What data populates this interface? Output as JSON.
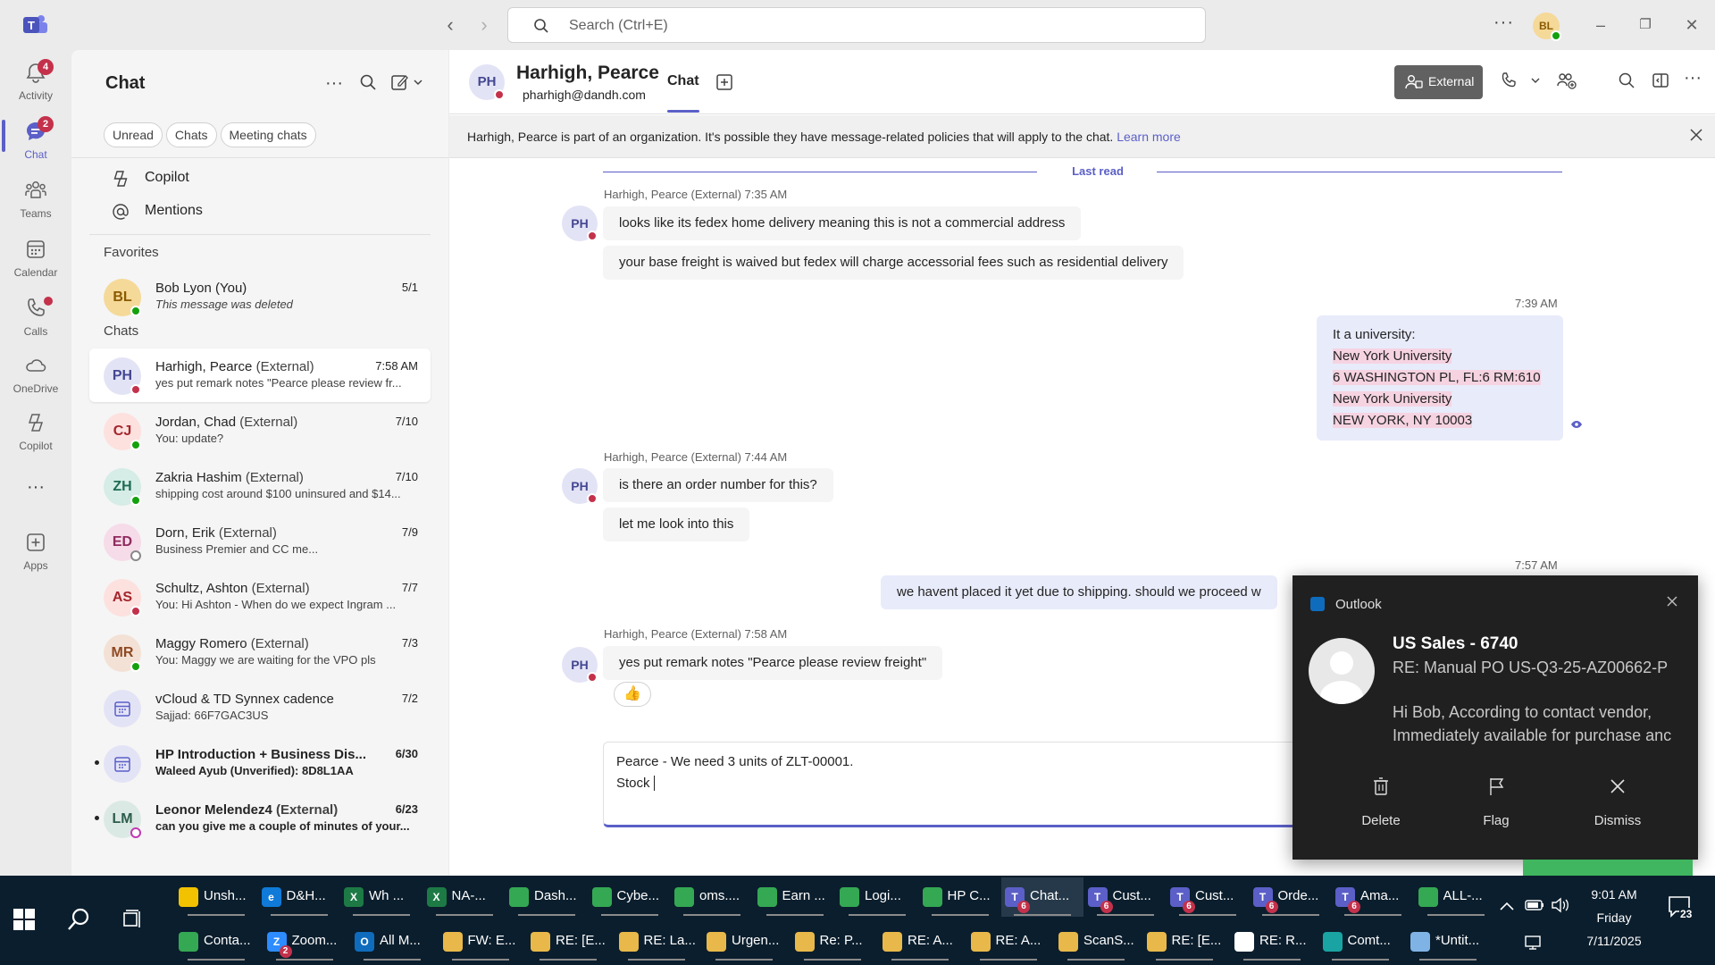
{
  "titlebar": {
    "search_placeholder": "Search (Ctrl+E)",
    "more": "···",
    "user_initials": "BL"
  },
  "rail": {
    "items": [
      {
        "label": "Activity",
        "badge": "4"
      },
      {
        "label": "Chat",
        "badge": "2"
      },
      {
        "label": "Teams"
      },
      {
        "label": "Calendar"
      },
      {
        "label": "Calls"
      },
      {
        "label": "OneDrive"
      },
      {
        "label": "Copilot"
      },
      {
        "label": "···"
      },
      {
        "label": "Apps"
      }
    ]
  },
  "list": {
    "title": "Chat",
    "filters": [
      "Unread",
      "Chats",
      "Meeting chats"
    ],
    "nav": [
      {
        "label": "Copilot"
      },
      {
        "label": "Mentions"
      }
    ],
    "favorites_label": "Favorites",
    "chats_label": "Chats",
    "favorites": [
      {
        "initials": "BL",
        "name": "Bob Lyon (You)",
        "preview": "This message was deleted",
        "date": "5/1"
      }
    ],
    "chats": [
      {
        "initials": "PH",
        "name": "Harhigh, Pearce",
        "ext": "(External)",
        "preview": "yes put remark notes \"Pearce please review fr...",
        "date": "7:58 AM"
      },
      {
        "initials": "CJ",
        "name": "Jordan, Chad",
        "ext": "(External)",
        "preview": "You: update?",
        "date": "7/10"
      },
      {
        "initials": "ZH",
        "name": "Zakria Hashim",
        "ext": "(External)",
        "preview": "shipping cost around $100 uninsured and $14...",
        "date": "7/10"
      },
      {
        "initials": "ED",
        "name": "Dorn, Erik",
        "ext": "(External)",
        "preview": "Business Premier and CC me...",
        "date": "7/9"
      },
      {
        "initials": "AS",
        "name": "Schultz, Ashton",
        "ext": "(External)",
        "preview": "You: Hi Ashton -  When do we expect Ingram ...",
        "date": "7/7"
      },
      {
        "initials": "MR",
        "name": "Maggy Romero",
        "ext": "(External)",
        "preview": "You: Maggy we are waiting for the VPO pls",
        "date": "7/3"
      },
      {
        "initials": "",
        "name": "vCloud & TD Synnex cadence",
        "ext": "",
        "preview": "Sajjad: 66F7GAC3US",
        "date": "7/2"
      },
      {
        "initials": "",
        "name": "HP Introduction + Business Dis...",
        "ext": "",
        "preview": "Waleed Ayub (Unverified): 8D8L1AA",
        "date": "6/30"
      },
      {
        "initials": "LM",
        "name": "Leonor Melendez4",
        "ext": "(External)",
        "preview": "can you give me a couple of minutes of your...",
        "date": "6/23"
      }
    ]
  },
  "header": {
    "initials": "PH",
    "name": "Harhigh, Pearce",
    "email": "pharhigh@dandh.com",
    "tab": "Chat",
    "external_label": "External"
  },
  "infobar": {
    "text": "Harhigh, Pearce is part of an organization. It's possible they have message-related policies that will apply to the chat.",
    "link": "Learn more"
  },
  "conversation": {
    "last_read": "Last read",
    "groups": [
      {
        "meta": "Harhigh, Pearce (External)  7:35 AM",
        "messages": [
          "looks like its fedex home delivery meaning this is not a commercial address",
          "your base freight is waived but fedex will charge accessorial fees such as residential delivery"
        ]
      },
      {
        "time": "7:39 AM",
        "lines": [
          "It a university:",
          "New York University",
          "6 WASHINGTON PL, FL:6 RM:610",
          "New York University",
          "NEW YORK, NY 10003"
        ]
      },
      {
        "meta": "Harhigh, Pearce (External)  7:44 AM",
        "messages": [
          "is there an order number for this?",
          "let me look into this"
        ]
      },
      {
        "time": "7:57 AM",
        "message": "we havent placed it yet due to shipping. should we proceed w"
      },
      {
        "meta": "Harhigh, Pearce (External)  7:58 AM",
        "messages": [
          "yes put remark notes \"Pearce please review freight\""
        ],
        "reaction": "👍"
      }
    ]
  },
  "compose": {
    "line1": "Pearce -  We need 3 units of ZLT-00001.",
    "line2": "Stock"
  },
  "toast": {
    "app": "Outlook",
    "sender": "US Sales - 6740",
    "subject": "RE: Manual PO    US-Q3-25-AZ00662-P",
    "body1": "Hi Bob,  According to contact vendor,",
    "body2": "Immediately available for purchase anc",
    "actions": [
      "Delete",
      "Flag",
      "Dismiss"
    ]
  },
  "taskbar": {
    "row1": [
      {
        "label": "Unsh...",
        "color": "#f2c200",
        "icon": ""
      },
      {
        "label": "D&H...",
        "color": "#0f7ad8",
        "icon": "e"
      },
      {
        "label": "Wh ...",
        "color": "#1d7a45",
        "icon": "X"
      },
      {
        "label": "NA-...",
        "color": "#1d7a45",
        "icon": "X"
      },
      {
        "label": "Dash...",
        "color": "#34a853",
        "icon": ""
      },
      {
        "label": "Cybe...",
        "color": "#34a853",
        "icon": ""
      },
      {
        "label": "oms....",
        "color": "#34a853",
        "icon": ""
      },
      {
        "label": "Earn ...",
        "color": "#34a853",
        "icon": ""
      },
      {
        "label": "Logi...",
        "color": "#34a853",
        "icon": ""
      },
      {
        "label": "HP C...",
        "color": "#34a853",
        "icon": ""
      },
      {
        "label": "Chat...",
        "color": "#5b5fc7",
        "icon": "T",
        "badge": "6",
        "active": true
      },
      {
        "label": "Cust...",
        "color": "#5b5fc7",
        "icon": "T",
        "badge": "6"
      },
      {
        "label": "Cust...",
        "color": "#5b5fc7",
        "icon": "T",
        "badge": "6"
      },
      {
        "label": "Orde...",
        "color": "#5b5fc7",
        "icon": "T",
        "badge": "6"
      },
      {
        "label": "Ama...",
        "color": "#5b5fc7",
        "icon": "T",
        "badge": "6"
      },
      {
        "label": "ALL-...",
        "color": "#34a853",
        "icon": ""
      }
    ],
    "row2": [
      {
        "label": "Conta...",
        "color": "#34a853",
        "icon": ""
      },
      {
        "label": "Zoom...",
        "color": "#2d8cff",
        "icon": "Z",
        "badge": "2"
      },
      {
        "label": "All M...",
        "color": "#0f6cbd",
        "icon": "O"
      },
      {
        "label": "FW: E...",
        "color": "#e8b84a",
        "icon": ""
      },
      {
        "label": "RE: [E...",
        "color": "#e8b84a",
        "icon": ""
      },
      {
        "label": "RE: La...",
        "color": "#e8b84a",
        "icon": ""
      },
      {
        "label": "Urgen...",
        "color": "#e8b84a",
        "icon": ""
      },
      {
        "label": "Re: P...",
        "color": "#e8b84a",
        "icon": ""
      },
      {
        "label": "RE: A...",
        "color": "#e8b84a",
        "icon": ""
      },
      {
        "label": "RE: A...",
        "color": "#e8b84a",
        "icon": ""
      },
      {
        "label": "ScanS...",
        "color": "#e8b84a",
        "icon": ""
      },
      {
        "label": "RE: [E...",
        "color": "#e8b84a",
        "icon": ""
      },
      {
        "label": "RE: R...",
        "color": "#ffffff",
        "icon": ""
      },
      {
        "label": "Comt...",
        "color": "#1aa3a3",
        "icon": ""
      },
      {
        "label": "*Untit...",
        "color": "#7fb3e6",
        "icon": ""
      }
    ],
    "time": "9:01 AM",
    "day": "Friday",
    "date": "7/11/2025",
    "notif_count": "23"
  }
}
